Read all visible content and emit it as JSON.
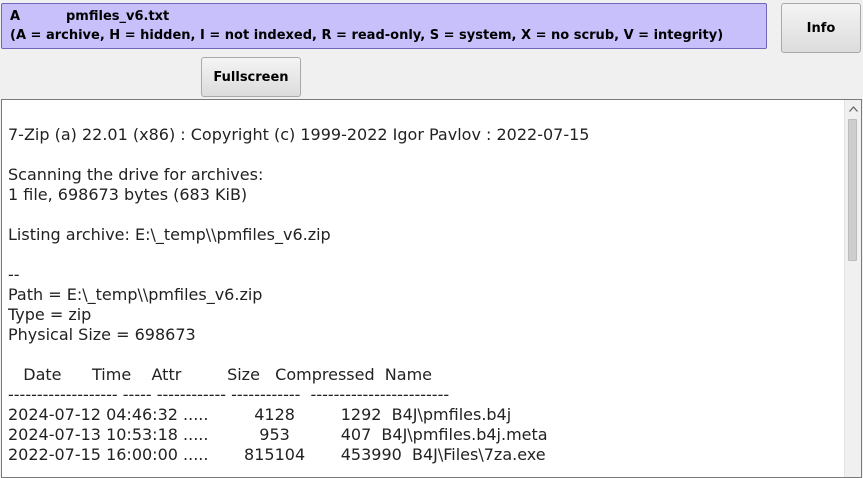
{
  "attributes_panel": {
    "code": "A",
    "filename": "pmfiles_v6.txt",
    "legend": "(A = archive, H = hidden, I = not indexed, R = read-only, S = system, X = no scrub, V = integrity)"
  },
  "buttons": {
    "info_label": "Info",
    "fullscreen_label": "Fullscreen"
  },
  "text_area": {
    "content": "7-Zip (a) 22.01 (x86) : Copyright (c) 1999-2022 Igor Pavlov : 2022-07-15\n\nScanning the drive for archives:\n1 file, 698673 bytes (683 KiB)\n\nListing archive: E:\\_temp\\\\pmfiles_v6.zip\n\n--\nPath = E:\\_temp\\\\pmfiles_v6.zip\nType = zip\nPhysical Size = 698673\n\n   Date      Time    Attr         Size   Compressed  Name\n------------------- ----- ------------ ------------  ------------------------\n2024-07-12 04:46:32 .....         4128         1292  B4J\\pmfiles.b4j\n2024-07-13 10:53:18 .....          953          407  B4J\\pmfiles.b4j.meta\n2022-07-15 16:00:00 .....       815104       453990  B4J\\Files\\7za.exe"
  },
  "icons": {
    "scroll_up": "scroll-up-arrow-icon"
  }
}
